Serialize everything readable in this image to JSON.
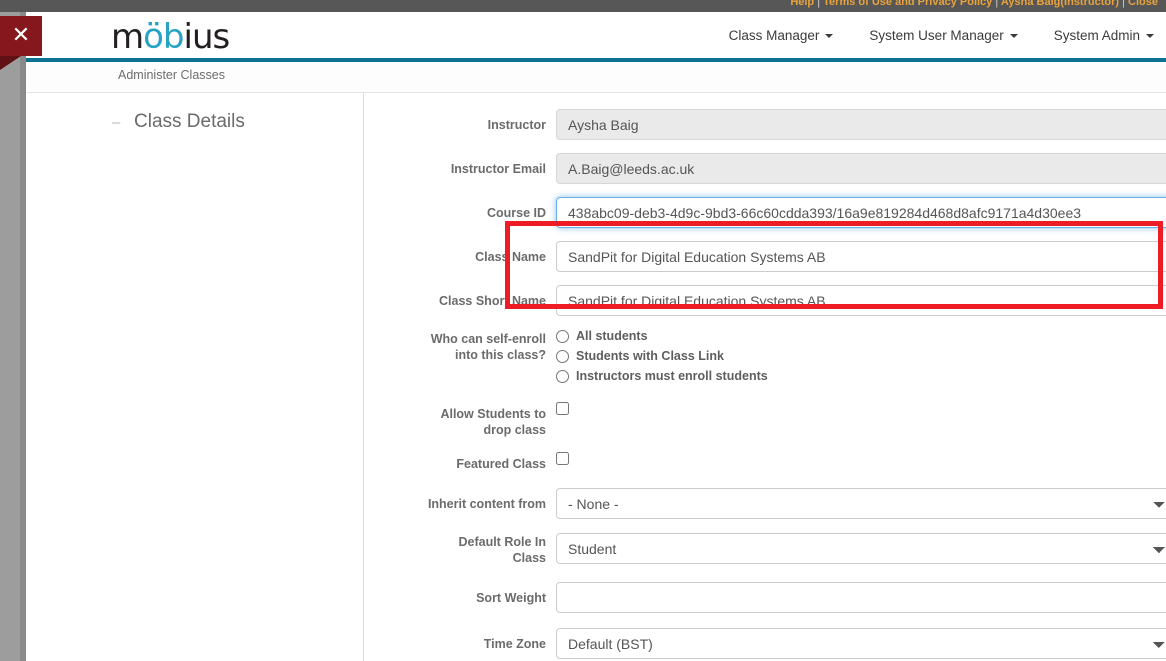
{
  "topbar": {
    "links": [
      "Help",
      "Terms of Use and Privacy Policy",
      "Aysha Baig(Instructor)",
      "Close"
    ],
    "separator": "|"
  },
  "header": {
    "logo_text_pre": "m",
    "logo_text_accent": "öb",
    "logo_text_post": "ius",
    "logo_name": "mobius",
    "nav": [
      {
        "label": "Class Manager"
      },
      {
        "label": "System User Manager"
      },
      {
        "label": "System Admin"
      }
    ]
  },
  "close_button": {
    "glyph": "✕",
    "title": "Close"
  },
  "breadcrumb": {
    "text": "Administer Classes"
  },
  "sidebar": {
    "toggle_glyph": "–",
    "section_label": "Class Details"
  },
  "form": {
    "fields": {
      "instructor": {
        "label": "Instructor",
        "value": "Aysha Baig"
      },
      "instructor_email": {
        "label": "Instructor Email",
        "value": "A.Baig@leeds.ac.uk"
      },
      "course_id": {
        "label": "Course ID",
        "value": "438abc09-deb3-4d9c-9bd3-66c60cdda393/16a9e819284d468d8afc9171a4d30ee3"
      },
      "class_name": {
        "label": "Class Name",
        "value": "SandPit for Digital Education Systems AB"
      },
      "class_short_name": {
        "label": "Class Short Name",
        "value": "SandPit for Digital Education Systems AB"
      },
      "self_enroll": {
        "label_line1": "Who can self-enroll",
        "label_line2": "into this class?",
        "options": [
          {
            "label": "All students",
            "checked": false
          },
          {
            "label": "Students with Class Link",
            "checked": false
          },
          {
            "label": "Instructors must enroll students",
            "checked": false
          }
        ]
      },
      "allow_drop": {
        "label_line1": "Allow Students to",
        "label_line2": "drop class",
        "checked": false
      },
      "featured_class": {
        "label": "Featured Class",
        "checked": false
      },
      "inherit_content": {
        "label": "Inherit content from",
        "value": "- None -"
      },
      "default_role": {
        "label_line1": "Default Role In",
        "label_line2": "Class",
        "value": "Student"
      },
      "sort_weight": {
        "label": "Sort Weight",
        "value": ""
      },
      "time_zone": {
        "label": "Time Zone",
        "value": "Default (BST)"
      }
    }
  },
  "annotation": {
    "highlight_color": "#ee1c24"
  },
  "colors": {
    "teal_rule": "#0d7191",
    "logo_accent": "#29a3c4",
    "close_ribbon": "#86181d"
  }
}
